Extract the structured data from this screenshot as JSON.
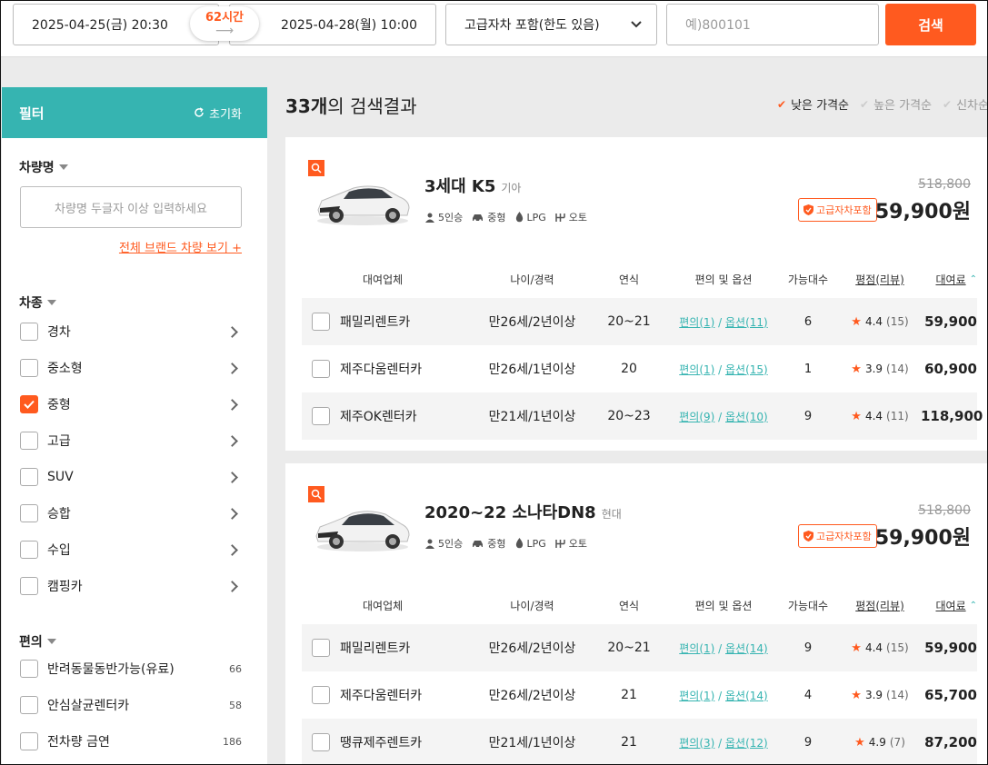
{
  "topbar": {
    "start_datetime": "2025-04-25(금) 20:30",
    "duration": "62시간",
    "duration_arrow": "⟶",
    "end_datetime": "2025-04-28(월) 10:00",
    "insurance_select": "고급자차 포함(한도 있음)",
    "code_placeholder": "예)800101",
    "search_label": "검색"
  },
  "filter": {
    "title": "필터",
    "reset_label": "초기화",
    "car_name_section": "차량명",
    "car_name_placeholder": "차량명 두글자 이상 입력하세요",
    "brand_link": "전체 브랜드 차량 보기 +",
    "car_type_section": "차종",
    "car_types": [
      {
        "label": "경차",
        "checked": false
      },
      {
        "label": "중소형",
        "checked": false
      },
      {
        "label": "중형",
        "checked": true
      },
      {
        "label": "고급",
        "checked": false
      },
      {
        "label": "SUV",
        "checked": false
      },
      {
        "label": "승합",
        "checked": false
      },
      {
        "label": "수입",
        "checked": false
      },
      {
        "label": "캠핑카",
        "checked": false
      }
    ],
    "convenience_section": "편의",
    "convenience": [
      {
        "label": "반려동물동반가능(유료)",
        "count": "66"
      },
      {
        "label": "안심살균렌터카",
        "count": "58"
      },
      {
        "label": "전차량 금연",
        "count": "186"
      }
    ]
  },
  "results": {
    "count_bold": "33개",
    "count_rest": "의 검색결과",
    "sorts": [
      {
        "label": "낮은 가격순",
        "active": true
      },
      {
        "label": "높은 가격순",
        "active": false
      },
      {
        "label": "신차순",
        "active": false
      }
    ]
  },
  "table_headers": {
    "company": "대여업체",
    "age": "나이/경력",
    "year": "연식",
    "options": "편의 및 옵션",
    "available": "가능대수",
    "rating": "평점(리뷰)",
    "price": "대여료"
  },
  "cars": [
    {
      "name": "3세대 K5",
      "maker": "기아",
      "seats": "5인승",
      "size": "중형",
      "fuel": "LPG",
      "transmission": "오토",
      "original_price": "518,800",
      "badge": "고급자차포함",
      "price": "59,900원",
      "body_color": "#f2f2f2",
      "rows": [
        {
          "company": "패밀리렌트카",
          "age": "만26세/2년이상",
          "year": "20~21",
          "conv": "편의(1)",
          "opt": "옵션(11)",
          "avail": "6",
          "rating": "4.4",
          "reviews": "(15)",
          "price": "59,900"
        },
        {
          "company": "제주다움렌터카",
          "age": "만26세/1년이상",
          "year": "20",
          "conv": "편의(1)",
          "opt": "옵션(15)",
          "avail": "1",
          "rating": "3.9",
          "reviews": "(14)",
          "price": "60,900"
        },
        {
          "company": "제주OK렌터카",
          "age": "만21세/1년이상",
          "year": "20~23",
          "conv": "편의(9)",
          "opt": "옵션(10)",
          "avail": "9",
          "rating": "4.4",
          "reviews": "(11)",
          "price": "118,900"
        }
      ]
    },
    {
      "name": "2020~22 소나타DN8",
      "maker": "현대",
      "seats": "5인승",
      "size": "중형",
      "fuel": "LPG",
      "transmission": "오토",
      "original_price": "518,800",
      "badge": "고급자차포함",
      "price": "59,900원",
      "body_color": "#f2f2f2",
      "rows": [
        {
          "company": "패밀리렌트카",
          "age": "만26세/2년이상",
          "year": "20~21",
          "conv": "편의(1)",
          "opt": "옵션(14)",
          "avail": "9",
          "rating": "4.4",
          "reviews": "(15)",
          "price": "59,900"
        },
        {
          "company": "제주다움렌터카",
          "age": "만26세/2년이상",
          "year": "21",
          "conv": "편의(1)",
          "opt": "옵션(14)",
          "avail": "4",
          "rating": "3.9",
          "reviews": "(14)",
          "price": "65,700"
        },
        {
          "company": "땡큐제주렌트카",
          "age": "만21세/1년이상",
          "year": "21",
          "conv": "편의(3)",
          "opt": "옵션(12)",
          "avail": "9",
          "rating": "4.9",
          "reviews": "(7)",
          "price": "87,200"
        }
      ]
    }
  ],
  "colors": {
    "accent": "#ff5a1f",
    "teal": "#36b4b1"
  }
}
